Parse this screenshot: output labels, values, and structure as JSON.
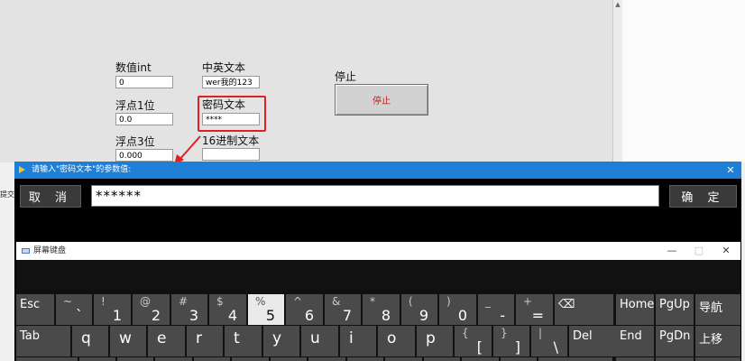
{
  "panel": {
    "int_label": "数值int",
    "int_value": "0",
    "float1_label": "浮点1位",
    "float1_value": "0.0",
    "float3_label": "浮点3位",
    "float3_value": "0.000",
    "zh_en_label": "中英文本",
    "zh_en_value": "wer我的123",
    "pwd_label": "密码文本",
    "pwd_value": "****",
    "hex_label": "16进制文本",
    "hex_value": "",
    "stop_label": "停止",
    "stop_button": "停止",
    "left_stub": "提交"
  },
  "dialog": {
    "title": "请输入\"密码文本\"的参数值:",
    "close": "✕",
    "cancel": "取 消",
    "ok": "确 定",
    "input_value": "******"
  },
  "osk": {
    "title": "屏幕键盘",
    "minimize": "—",
    "maximize": "□",
    "close": "✕",
    "row1": [
      {
        "main": "Esc"
      },
      {
        "shift": "~",
        "main": "`"
      },
      {
        "shift": "!",
        "main": "1"
      },
      {
        "shift": "@",
        "main": "2"
      },
      {
        "shift": "#",
        "main": "3"
      },
      {
        "shift": "$",
        "main": "4"
      },
      {
        "shift": "%",
        "main": "5"
      },
      {
        "shift": "^",
        "main": "6"
      },
      {
        "shift": "&",
        "main": "7"
      },
      {
        "shift": "*",
        "main": "8"
      },
      {
        "shift": "(",
        "main": "9"
      },
      {
        "shift": ")",
        "main": "0"
      },
      {
        "shift": "_",
        "main": "-"
      },
      {
        "shift": "+",
        "main": "="
      },
      {
        "main": "⌫"
      },
      {
        "main": "Home"
      },
      {
        "main": "PgUp"
      },
      {
        "main": "导航"
      }
    ],
    "row2": [
      {
        "main": "Tab"
      },
      {
        "main": "q"
      },
      {
        "main": "w"
      },
      {
        "main": "e"
      },
      {
        "main": "r"
      },
      {
        "main": "t"
      },
      {
        "main": "y"
      },
      {
        "main": "u"
      },
      {
        "main": "i"
      },
      {
        "main": "o"
      },
      {
        "main": "p"
      },
      {
        "shift": "{",
        "main": "["
      },
      {
        "shift": "}",
        "main": "]"
      },
      {
        "shift": "|",
        "main": "\\"
      },
      {
        "main": "Del"
      },
      {
        "main": "End"
      },
      {
        "main": "PgDn"
      },
      {
        "main": "上移"
      }
    ],
    "active_key": "5"
  },
  "colors": {
    "dialog_title_bg": "#1f7ed6",
    "highlight": "#e02020",
    "stop_text": "#d21414"
  }
}
